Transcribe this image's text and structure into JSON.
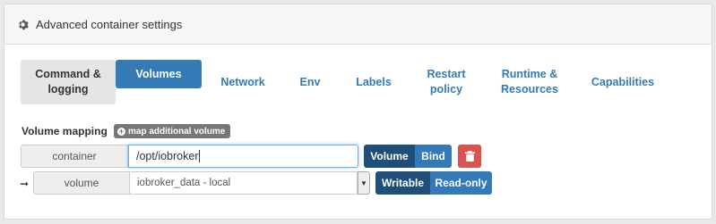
{
  "header": {
    "title": "Advanced container settings",
    "icon": "gear-icon"
  },
  "tabs": [
    {
      "label": "Command &\nlogging",
      "state": "grey"
    },
    {
      "label": "Volumes",
      "state": "active"
    },
    {
      "label": "Network",
      "state": "normal"
    },
    {
      "label": "Env",
      "state": "normal"
    },
    {
      "label": "Labels",
      "state": "normal"
    },
    {
      "label": "Restart\npolicy",
      "state": "normal"
    },
    {
      "label": "Runtime &\nResources",
      "state": "normal"
    },
    {
      "label": "Capabilities",
      "state": "normal"
    }
  ],
  "volumes": {
    "mapping_label": "Volume mapping",
    "map_button": "map additional volume",
    "row1": {
      "addon": "container",
      "input_value": "/opt/iobroker",
      "type_options": [
        "Volume",
        "Bind"
      ],
      "type_selected": "Volume"
    },
    "row2": {
      "arrow": "➞",
      "addon": "volume",
      "select_value": "iobroker_data - local",
      "mode_options": [
        "Writable",
        "Read-only"
      ],
      "mode_selected": "Writable"
    }
  },
  "colors": {
    "primary": "#337ab7",
    "dark": "#1f4e79",
    "danger": "#d9534f"
  }
}
